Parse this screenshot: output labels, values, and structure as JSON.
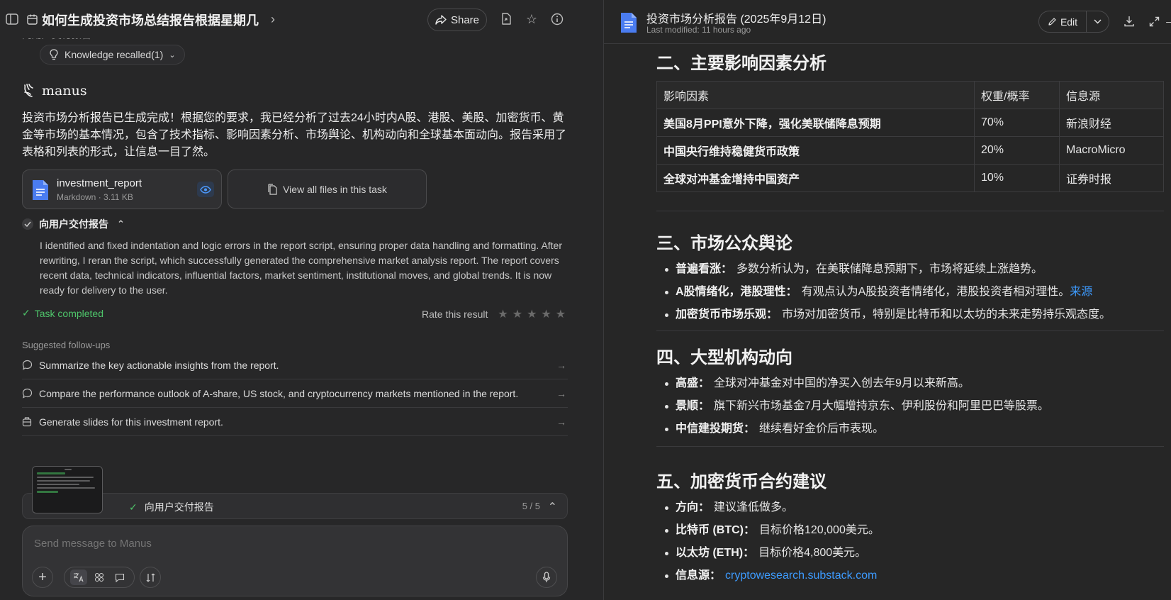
{
  "chat": {
    "title": "如何生成投资市场总结报告根据星期几",
    "share_label": "Share",
    "previous_step_peek": "向用户交付报告",
    "knowledge_label": "Knowledge recalled(1)",
    "brand": "manus",
    "summary": "投资市场分析报告已生成完成！根据您的要求，我已经分析了过去24小时内A股、港股、美股、加密货币、黄金等市场的基本情况，包含了技术指标、影响因素分析、市场舆论、机构动向和全球基本面动向。报告采用了表格和列表的形式，让信息一目了然。",
    "file": {
      "name": "investment_report",
      "meta": "Markdown · 3.11 KB"
    },
    "view_all_label": "View all files in this task",
    "step": {
      "title": "向用户交付报告",
      "detail": "I identified and fixed indentation and logic errors in the report script, ensuring proper data handling and formatting. After rewriting, I reran the script, which successfully generated the comprehensive market analysis report. The report covers recent data, technical indicators, influential factors, market sentiment, institutional moves, and global trends. It is now ready for delivery to the user."
    },
    "task_completed": "Task completed",
    "rate_label": "Rate this result",
    "rating": 0,
    "suggestions_title": "Suggested follow-ups",
    "suggestions": [
      {
        "text": "Summarize the key actionable insights from the report.",
        "icon": "chat-bubble-icon"
      },
      {
        "text": "Compare the performance outlook of A-share, US stock, and cryptocurrency markets mentioned in the report.",
        "icon": "chat-bubble-icon"
      },
      {
        "text": "Generate slides for this investment report.",
        "icon": "slides-icon"
      }
    ],
    "progress": {
      "label": "向用户交付报告",
      "count": "5 / 5"
    },
    "composer_placeholder": "Send message to Manus"
  },
  "document": {
    "title": "投资市场分析报告 (2025年9月12日)",
    "modified": "Last modified: 11 hours ago",
    "edit_label": "Edit",
    "sections": {
      "factors": {
        "heading": "二、主要影响因素分析",
        "columns": [
          "影响因素",
          "权重/概率",
          "信息源"
        ],
        "rows": [
          [
            "美国8月PPI意外下降，强化美联储降息预期",
            "70%",
            "新浪财经"
          ],
          [
            "中国央行维持稳健货币政策",
            "20%",
            "MacroMicro"
          ],
          [
            "全球对冲基金增持中国资产",
            "10%",
            "证券时报"
          ]
        ]
      },
      "sentiment": {
        "heading": "三、市场公众舆论",
        "items": [
          {
            "label": "普遍看涨：",
            "text": "多数分析认为，在美联储降息预期下，市场将延续上涨趋势。",
            "link": ""
          },
          {
            "label": "A股情绪化，港股理性：",
            "text": "有观点认为A股投资者情绪化，港股投资者相对理性。",
            "link": "来源"
          },
          {
            "label": "加密货币市场乐观：",
            "text": "市场对加密货币，特别是比特币和以太坊的未来走势持乐观态度。",
            "link": ""
          }
        ]
      },
      "institutions": {
        "heading": "四、大型机构动向",
        "items": [
          {
            "label": "高盛：",
            "text": "全球对冲基金对中国的净买入创去年9月以来新高。"
          },
          {
            "label": "景顺：",
            "text": "旗下新兴市场基金7月大幅增持京东、伊利股份和阿里巴巴等股票。"
          },
          {
            "label": "中信建投期货：",
            "text": "继续看好金价后市表现。"
          }
        ]
      },
      "crypto": {
        "heading": "五、加密货币合约建议",
        "items": [
          {
            "label": "方向：",
            "text": "建议逢低做多。",
            "link": ""
          },
          {
            "label": "比特币 (BTC)：",
            "text": "目标价格120,000美元。",
            "link": ""
          },
          {
            "label": "以太坊 (ETH)：",
            "text": "目标价格4,800美元。",
            "link": ""
          },
          {
            "label": "信息源：",
            "text": "",
            "link": "cryptowesearch.substack.com"
          }
        ]
      }
    }
  },
  "colors": {
    "background": "#272728",
    "link": "#3d9bff",
    "success": "#4ec46a",
    "doc_icon": "#4a7cf0"
  }
}
